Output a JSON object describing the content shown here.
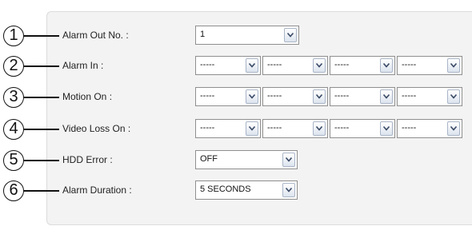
{
  "rows": [
    {
      "num": "1",
      "label": "Alarm Out No. :",
      "values": [
        "1"
      ]
    },
    {
      "num": "2",
      "label": "Alarm In :",
      "values": [
        "-----",
        "-----",
        "-----",
        "-----"
      ]
    },
    {
      "num": "3",
      "label": "Motion On :",
      "values": [
        "-----",
        "-----",
        "-----",
        "-----"
      ]
    },
    {
      "num": "4",
      "label": "Video Loss On :",
      "values": [
        "-----",
        "-----",
        "-----",
        "-----"
      ]
    },
    {
      "num": "5",
      "label": "HDD Error :",
      "values": [
        "OFF"
      ]
    },
    {
      "num": "6",
      "label": "Alarm Duration :",
      "values": [
        "5 SECONDS"
      ]
    }
  ],
  "icons": {
    "dropdown": "chevron-down-icon"
  }
}
